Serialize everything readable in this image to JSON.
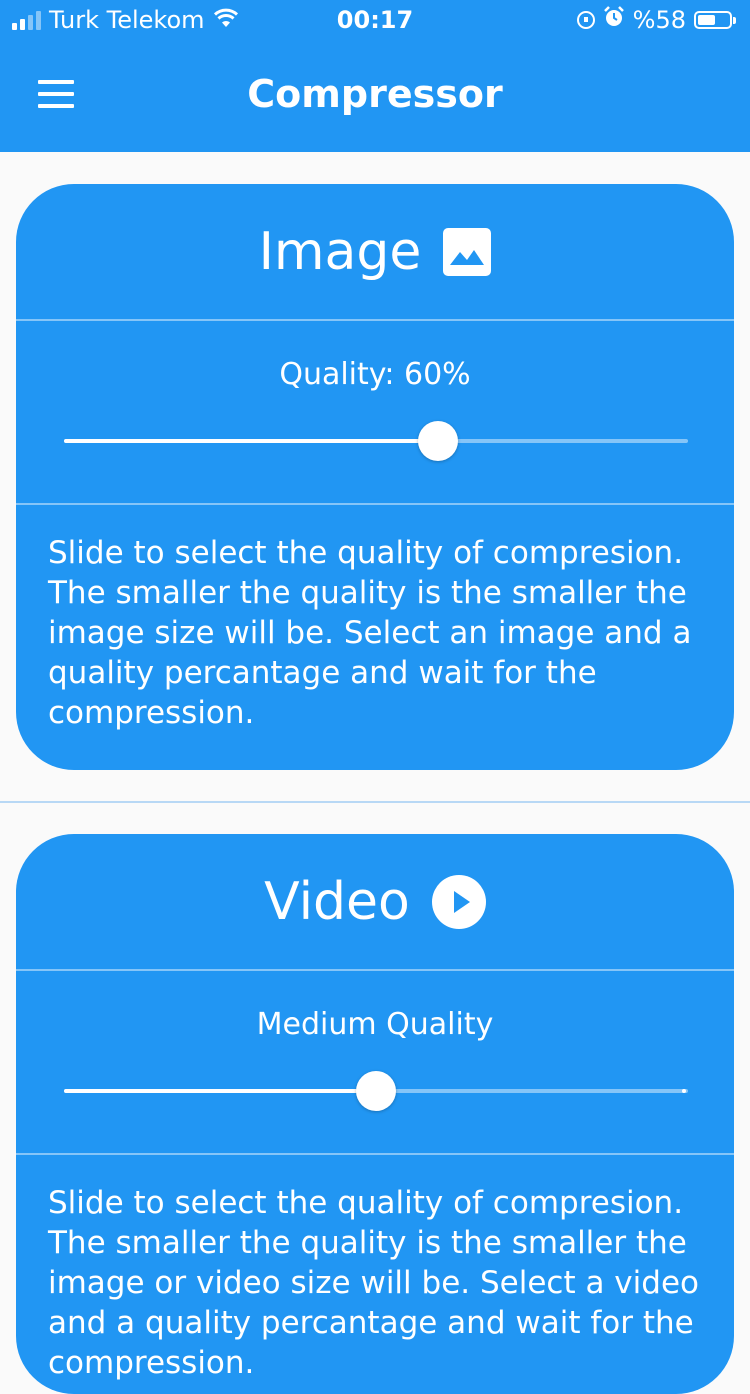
{
  "status_bar": {
    "carrier": "Turk Telekom",
    "time": "00:17",
    "battery": "%58",
    "battery_level": 0.58,
    "icons": [
      "signal-icon",
      "wifi-icon",
      "lock-rotation-icon",
      "alarm-icon",
      "battery-icon"
    ]
  },
  "app_bar": {
    "title": "Compressor",
    "menu_icon": "menu-icon"
  },
  "image_card": {
    "title": "Image",
    "icon": "image-icon",
    "quality_label": "Quality: 60%",
    "slider_value": 0.6,
    "description": "Slide to select the quality of compresion. The smaller the quality is the smaller the image size will be. Select an image and a quality percantage and wait for the compression."
  },
  "video_card": {
    "title": "Video",
    "icon": "play-circle-icon",
    "quality_label": "Medium Quality",
    "slider_value": 0.5,
    "description": "Slide to select the quality of compresion. The smaller the quality is the smaller the image or video size will be. Select a video and a quality percantage and wait for the compression."
  },
  "colors": {
    "primary": "#2196f3",
    "background": "#fafafa",
    "text_on_primary": "#ffffff"
  }
}
